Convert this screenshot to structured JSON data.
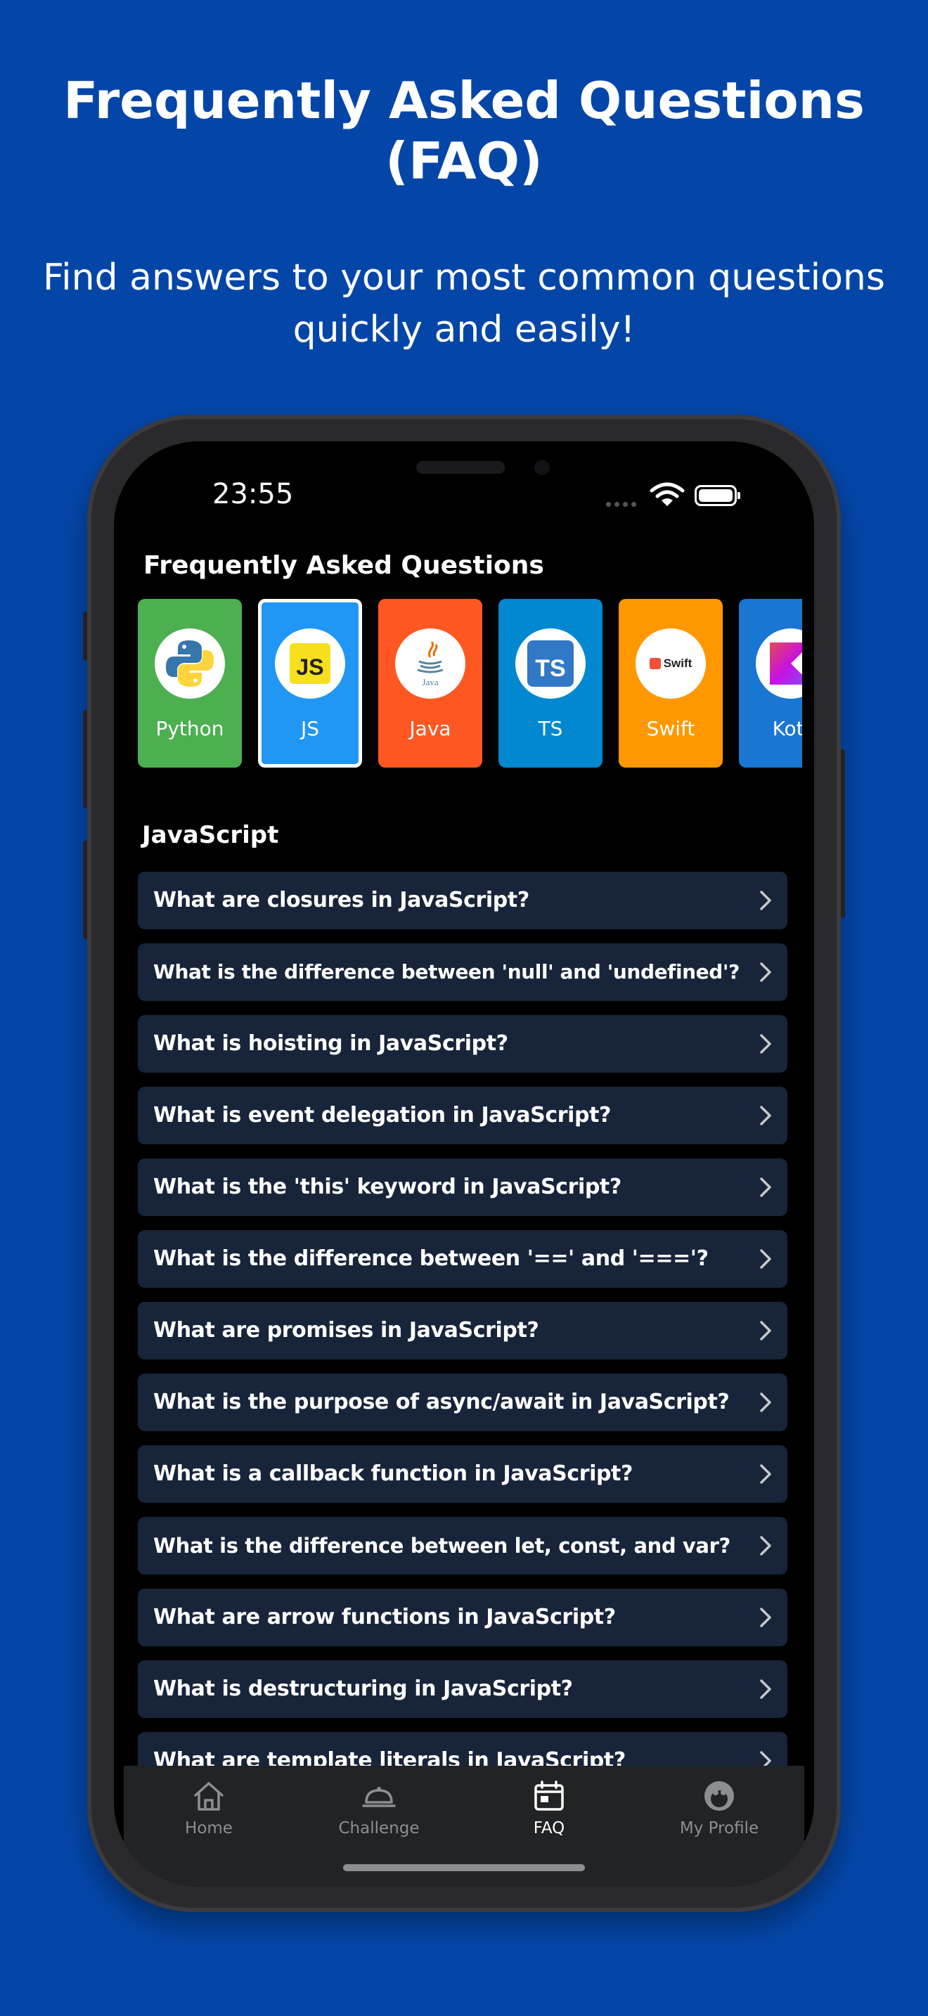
{
  "promo": {
    "title": "Frequently Asked Questions (FAQ)",
    "subtitle": "Find answers to your most common questions quickly and easily!"
  },
  "status_bar": {
    "time": "23:55"
  },
  "screen": {
    "title": "Frequently Asked Questions"
  },
  "categories": [
    {
      "label": "Python",
      "color": "#4caf50",
      "icon": "python-logo-icon",
      "selected": false
    },
    {
      "label": "JS",
      "color": "#2196f3",
      "icon": "javascript-logo-icon",
      "selected": true
    },
    {
      "label": "Java",
      "color": "#ff5722",
      "icon": "java-logo-icon",
      "selected": false
    },
    {
      "label": "TS",
      "color": "#0288d1",
      "icon": "typescript-logo-icon",
      "selected": false
    },
    {
      "label": "Swift",
      "color": "#ff9800",
      "icon": "swift-logo-icon",
      "selected": false
    },
    {
      "label": "Kotl",
      "color": "#1976d2",
      "icon": "kotlin-logo-icon",
      "selected": false
    }
  ],
  "section": {
    "title": "JavaScript"
  },
  "faqs": [
    "What are closures in JavaScript?",
    "What is the difference between 'null' and 'undefined'?",
    "What is hoisting in JavaScript?",
    "What is event delegation in JavaScript?",
    "What is the 'this' keyword in JavaScript?",
    "What is the difference between '==' and '==='?",
    "What are promises in JavaScript?",
    "What is the purpose of async/await in JavaScript?",
    "What is a callback function in JavaScript?",
    "What is the difference between let, const, and var?",
    "What are arrow functions in JavaScript?",
    "What is destructuring in JavaScript?",
    "What are template literals in JavaScript?"
  ],
  "tabs": [
    {
      "label": "Home",
      "icon": "home-icon",
      "active": false
    },
    {
      "label": "Challenge",
      "icon": "cloche-icon",
      "active": false
    },
    {
      "label": "FAQ",
      "icon": "calendar-icon",
      "active": true
    },
    {
      "label": "My Profile",
      "icon": "profile-icon",
      "active": false
    }
  ],
  "colors": {
    "background": "#0446a8",
    "item_background": "#17243a",
    "tabbar_background": "#222325",
    "tab_inactive": "#8d8e91"
  }
}
